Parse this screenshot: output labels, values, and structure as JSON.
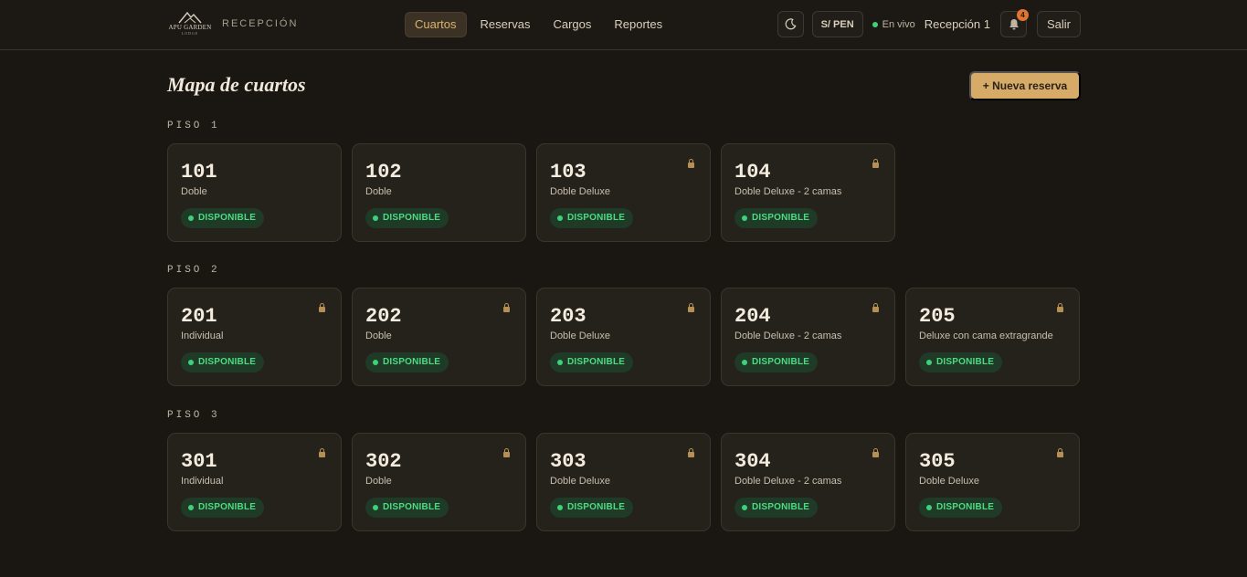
{
  "brand": {
    "logo_text": "APU GARDEN",
    "logo_sub": "LODGE",
    "section": "RECEPCIÓN"
  },
  "nav": [
    {
      "label": "Cuartos",
      "active": true
    },
    {
      "label": "Reservas",
      "active": false
    },
    {
      "label": "Cargos",
      "active": false
    },
    {
      "label": "Reportes",
      "active": false
    }
  ],
  "header": {
    "theme_icon": "moon-icon",
    "currency": "S/ PEN",
    "live_status": "En vivo",
    "user": "Recepción 1",
    "notifications_count": "4",
    "logout": "Salir"
  },
  "main": {
    "title": "Mapa de cuartos",
    "new_booking": "+ Nueva reserva"
  },
  "colors": {
    "accent": "#d6ab68",
    "available": "#4ddb83",
    "background": "#1a1713"
  },
  "floors": [
    {
      "label": "PISO 1",
      "rooms": [
        {
          "number": "101",
          "type": "Doble",
          "status": "DISPONIBLE",
          "locked": false
        },
        {
          "number": "102",
          "type": "Doble",
          "status": "DISPONIBLE",
          "locked": false
        },
        {
          "number": "103",
          "type": "Doble Deluxe",
          "status": "DISPONIBLE",
          "locked": true
        },
        {
          "number": "104",
          "type": "Doble Deluxe - 2 camas",
          "status": "DISPONIBLE",
          "locked": true
        }
      ]
    },
    {
      "label": "PISO 2",
      "rooms": [
        {
          "number": "201",
          "type": "Individual",
          "status": "DISPONIBLE",
          "locked": true
        },
        {
          "number": "202",
          "type": "Doble",
          "status": "DISPONIBLE",
          "locked": true
        },
        {
          "number": "203",
          "type": "Doble Deluxe",
          "status": "DISPONIBLE",
          "locked": true
        },
        {
          "number": "204",
          "type": "Doble Deluxe - 2 camas",
          "status": "DISPONIBLE",
          "locked": true
        },
        {
          "number": "205",
          "type": "Deluxe con cama extragrande",
          "status": "DISPONIBLE",
          "locked": true
        }
      ]
    },
    {
      "label": "PISO 3",
      "rooms": [
        {
          "number": "301",
          "type": "Individual",
          "status": "DISPONIBLE",
          "locked": true
        },
        {
          "number": "302",
          "type": "Doble",
          "status": "DISPONIBLE",
          "locked": true
        },
        {
          "number": "303",
          "type": "Doble Deluxe",
          "status": "DISPONIBLE",
          "locked": true
        },
        {
          "number": "304",
          "type": "Doble Deluxe - 2 camas",
          "status": "DISPONIBLE",
          "locked": true
        },
        {
          "number": "305",
          "type": "Doble Deluxe",
          "status": "DISPONIBLE",
          "locked": true
        }
      ]
    }
  ]
}
